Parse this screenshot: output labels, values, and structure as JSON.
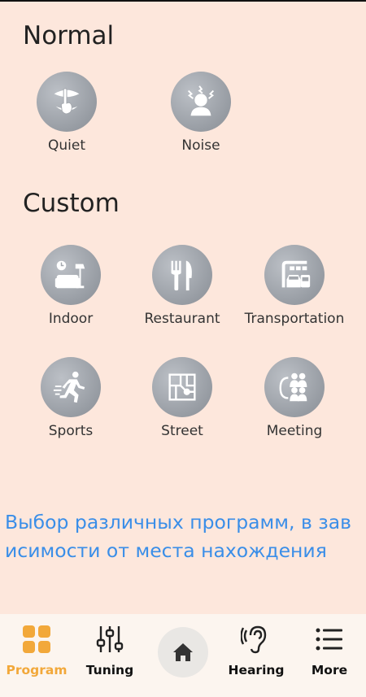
{
  "sections": {
    "normal_title": "Normal",
    "custom_title": "Custom"
  },
  "programs": {
    "quiet": {
      "label": "Quiet",
      "icon": "quiet-shush-icon"
    },
    "noise": {
      "label": "Noise",
      "icon": "noise-head-icon"
    },
    "indoor": {
      "label": "Indoor",
      "icon": "indoor-sofa-icon"
    },
    "restaurant": {
      "label": "Restaurant",
      "icon": "fork-knife-icon"
    },
    "transportation": {
      "label": "Transportation",
      "icon": "bus-car-icon"
    },
    "sports": {
      "label": "Sports",
      "icon": "runner-icon"
    },
    "street": {
      "label": "Street",
      "icon": "street-map-icon"
    },
    "meeting": {
      "label": "Meeting",
      "icon": "meeting-people-icon"
    }
  },
  "description": "Выбор различных программ, в зависимости от места нахождения",
  "nav": {
    "program": {
      "label": "Program",
      "icon": "grid-icon",
      "active": true
    },
    "tuning": {
      "label": "Tuning",
      "icon": "sliders-icon"
    },
    "home": {
      "icon": "home-icon"
    },
    "hearing": {
      "label": "Hearing",
      "icon": "ear-icon"
    },
    "more": {
      "label": "More",
      "icon": "list-icon"
    }
  },
  "colors": {
    "background": "#fde7dc",
    "accent": "#f2a83a",
    "description_text": "#3a8ee8",
    "icon_circle": "#979ca3",
    "nav_background": "#fcf5ef"
  }
}
